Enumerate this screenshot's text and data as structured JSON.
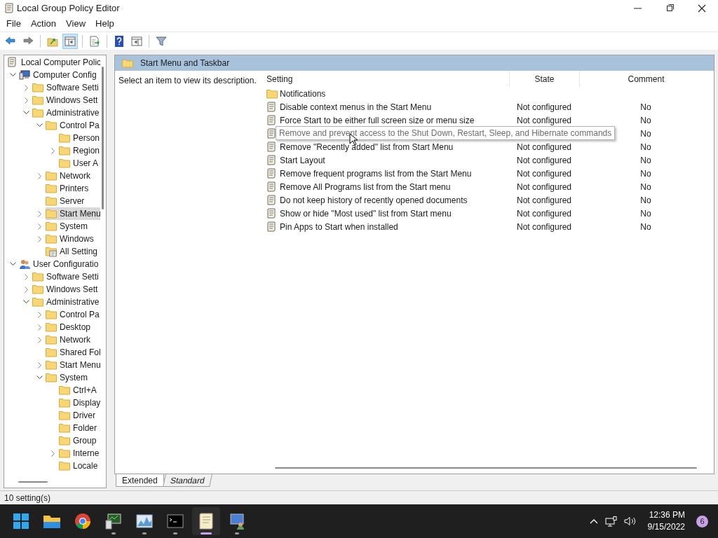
{
  "window": {
    "title": "Local Group Policy Editor"
  },
  "menu": [
    "File",
    "Action",
    "View",
    "Help"
  ],
  "toolbar": [
    {
      "kind": "back",
      "pressed": false
    },
    {
      "kind": "forward",
      "pressed": false
    },
    {
      "kind": "sep"
    },
    {
      "kind": "up",
      "pressed": false
    },
    {
      "kind": "tree",
      "pressed": true
    },
    {
      "kind": "sep"
    },
    {
      "kind": "export",
      "pressed": false
    },
    {
      "kind": "sep"
    },
    {
      "kind": "help",
      "pressed": false
    },
    {
      "kind": "pane",
      "pressed": false
    },
    {
      "kind": "sep"
    },
    {
      "kind": "filter",
      "pressed": false
    }
  ],
  "tree": [
    {
      "label": "Local Computer Polic",
      "kind": "policy",
      "selected": false,
      "children": [
        {
          "label": "Computer Config",
          "kind": "computer",
          "expanded": true,
          "selected": false,
          "children": [
            {
              "label": "Software Setti",
              "kind": "folder",
              "expanded": false,
              "selected": false
            },
            {
              "label": "Windows Sett",
              "kind": "folder",
              "expanded": false,
              "selected": false
            },
            {
              "label": "Administrative",
              "kind": "folder",
              "expanded": true,
              "selected": false,
              "children": [
                {
                  "label": "Control Pa",
                  "kind": "folder",
                  "expanded": true,
                  "selected": false,
                  "children": [
                    {
                      "label": "Person",
                      "kind": "folder",
                      "selected": false
                    },
                    {
                      "label": "Region",
                      "kind": "folder",
                      "expanded": false,
                      "selected": false
                    },
                    {
                      "label": "User A",
                      "kind": "folder",
                      "selected": false
                    }
                  ]
                },
                {
                  "label": "Network",
                  "kind": "folder",
                  "expanded": false,
                  "selected": false
                },
                {
                  "label": "Printers",
                  "kind": "folder",
                  "selected": false
                },
                {
                  "label": "Server",
                  "kind": "folder",
                  "selected": false
                },
                {
                  "label": "Start Menu",
                  "kind": "folder",
                  "expanded": false,
                  "selected": true
                },
                {
                  "label": "System",
                  "kind": "folder",
                  "expanded": false,
                  "selected": false
                },
                {
                  "label": "Windows",
                  "kind": "folder",
                  "expanded": false,
                  "selected": false
                },
                {
                  "label": "All Setting",
                  "kind": "allsettings",
                  "selected": false
                }
              ]
            }
          ]
        },
        {
          "label": "User Configuratio",
          "kind": "user",
          "expanded": true,
          "selected": false,
          "children": [
            {
              "label": "Software Setti",
              "kind": "folder",
              "expanded": false,
              "selected": false
            },
            {
              "label": "Windows Sett",
              "kind": "folder",
              "expanded": false,
              "selected": false
            },
            {
              "label": "Administrative",
              "kind": "folder",
              "expanded": true,
              "selected": false,
              "children": [
                {
                  "label": "Control Pa",
                  "kind": "folder",
                  "expanded": false,
                  "selected": false
                },
                {
                  "label": "Desktop",
                  "kind": "folder",
                  "expanded": false,
                  "selected": false
                },
                {
                  "label": "Network",
                  "kind": "folder",
                  "expanded": false,
                  "selected": false
                },
                {
                  "label": "Shared Fol",
                  "kind": "folder",
                  "selected": false
                },
                {
                  "label": "Start Menu",
                  "kind": "folder",
                  "expanded": false,
                  "selected": false
                },
                {
                  "label": "System",
                  "kind": "folder",
                  "expanded": true,
                  "selected": false,
                  "children": [
                    {
                      "label": "Ctrl+A",
                      "kind": "folder",
                      "selected": false
                    },
                    {
                      "label": "Display",
                      "kind": "folder",
                      "selected": false
                    },
                    {
                      "label": "Driver",
                      "kind": "folder",
                      "selected": false
                    },
                    {
                      "label": "Folder",
                      "kind": "folder",
                      "selected": false
                    },
                    {
                      "label": "Group",
                      "kind": "folder",
                      "selected": false
                    },
                    {
                      "label": "Interne",
                      "kind": "folder",
                      "expanded": false,
                      "selected": false
                    },
                    {
                      "label": "Locale",
                      "kind": "folder",
                      "selected": false
                    }
                  ]
                }
              ]
            }
          ]
        }
      ]
    }
  ],
  "pane": {
    "title": "Start Menu and Taskbar",
    "description": "Select an item to view its description.",
    "columns": [
      "Setting",
      "State",
      "Comment"
    ],
    "rows": [
      {
        "kind": "folder",
        "setting": "Notifications",
        "hovered": false
      },
      {
        "kind": "policy",
        "setting": "Disable context menus in the Start Menu",
        "state": "Not configured",
        "comment": "No",
        "hovered": false
      },
      {
        "kind": "policy",
        "setting": "Force Start to be either full screen size or menu size",
        "state": "Not configured",
        "comment": "No",
        "hovered": false
      },
      {
        "kind": "policy",
        "setting": "Remove and prevent access to the Shut Down, Restart, Sleep, and Hibernate commands",
        "comment": "No",
        "hovered": true
      },
      {
        "kind": "policy",
        "setting": "Remove \"Recently added\" list from Start Menu",
        "state": "Not configured",
        "comment": "No",
        "hovered": false
      },
      {
        "kind": "policy",
        "setting": "Start Layout",
        "state": "Not configured",
        "comment": "No",
        "hovered": false
      },
      {
        "kind": "policy",
        "setting": "Remove frequent programs list from the Start Menu",
        "state": "Not configured",
        "comment": "No",
        "hovered": false
      },
      {
        "kind": "policy",
        "setting": "Remove All Programs list from the Start menu",
        "state": "Not configured",
        "comment": "No",
        "hovered": false
      },
      {
        "kind": "policy",
        "setting": "Do not keep history of recently opened documents",
        "state": "Not configured",
        "comment": "No",
        "hovered": false
      },
      {
        "kind": "policy",
        "setting": "Show or hide \"Most used\" list from Start menu",
        "state": "Not configured",
        "comment": "No",
        "hovered": false
      },
      {
        "kind": "policy",
        "setting": "Pin Apps to Start when installed",
        "state": "Not configured",
        "comment": "No",
        "hovered": false
      }
    ],
    "tabs": [
      {
        "label": "Extended",
        "selected": true
      },
      {
        "label": "Standard",
        "selected": false
      }
    ]
  },
  "status_bar": "10 setting(s)",
  "taskbar": {
    "apps": [
      {
        "kind": "start",
        "running": false,
        "active": false
      },
      {
        "kind": "explorer",
        "running": false,
        "active": false
      },
      {
        "kind": "chrome",
        "running": false,
        "active": false
      },
      {
        "kind": "monitor",
        "running": true,
        "active": false
      },
      {
        "kind": "perf",
        "running": true,
        "active": false
      },
      {
        "kind": "terminal",
        "running": true,
        "active": false
      },
      {
        "kind": "notepad",
        "running": true,
        "active": true
      },
      {
        "kind": "remote",
        "running": true,
        "active": false
      }
    ],
    "time": "12:36 PM",
    "date": "9/15/2022",
    "badge": "6"
  }
}
